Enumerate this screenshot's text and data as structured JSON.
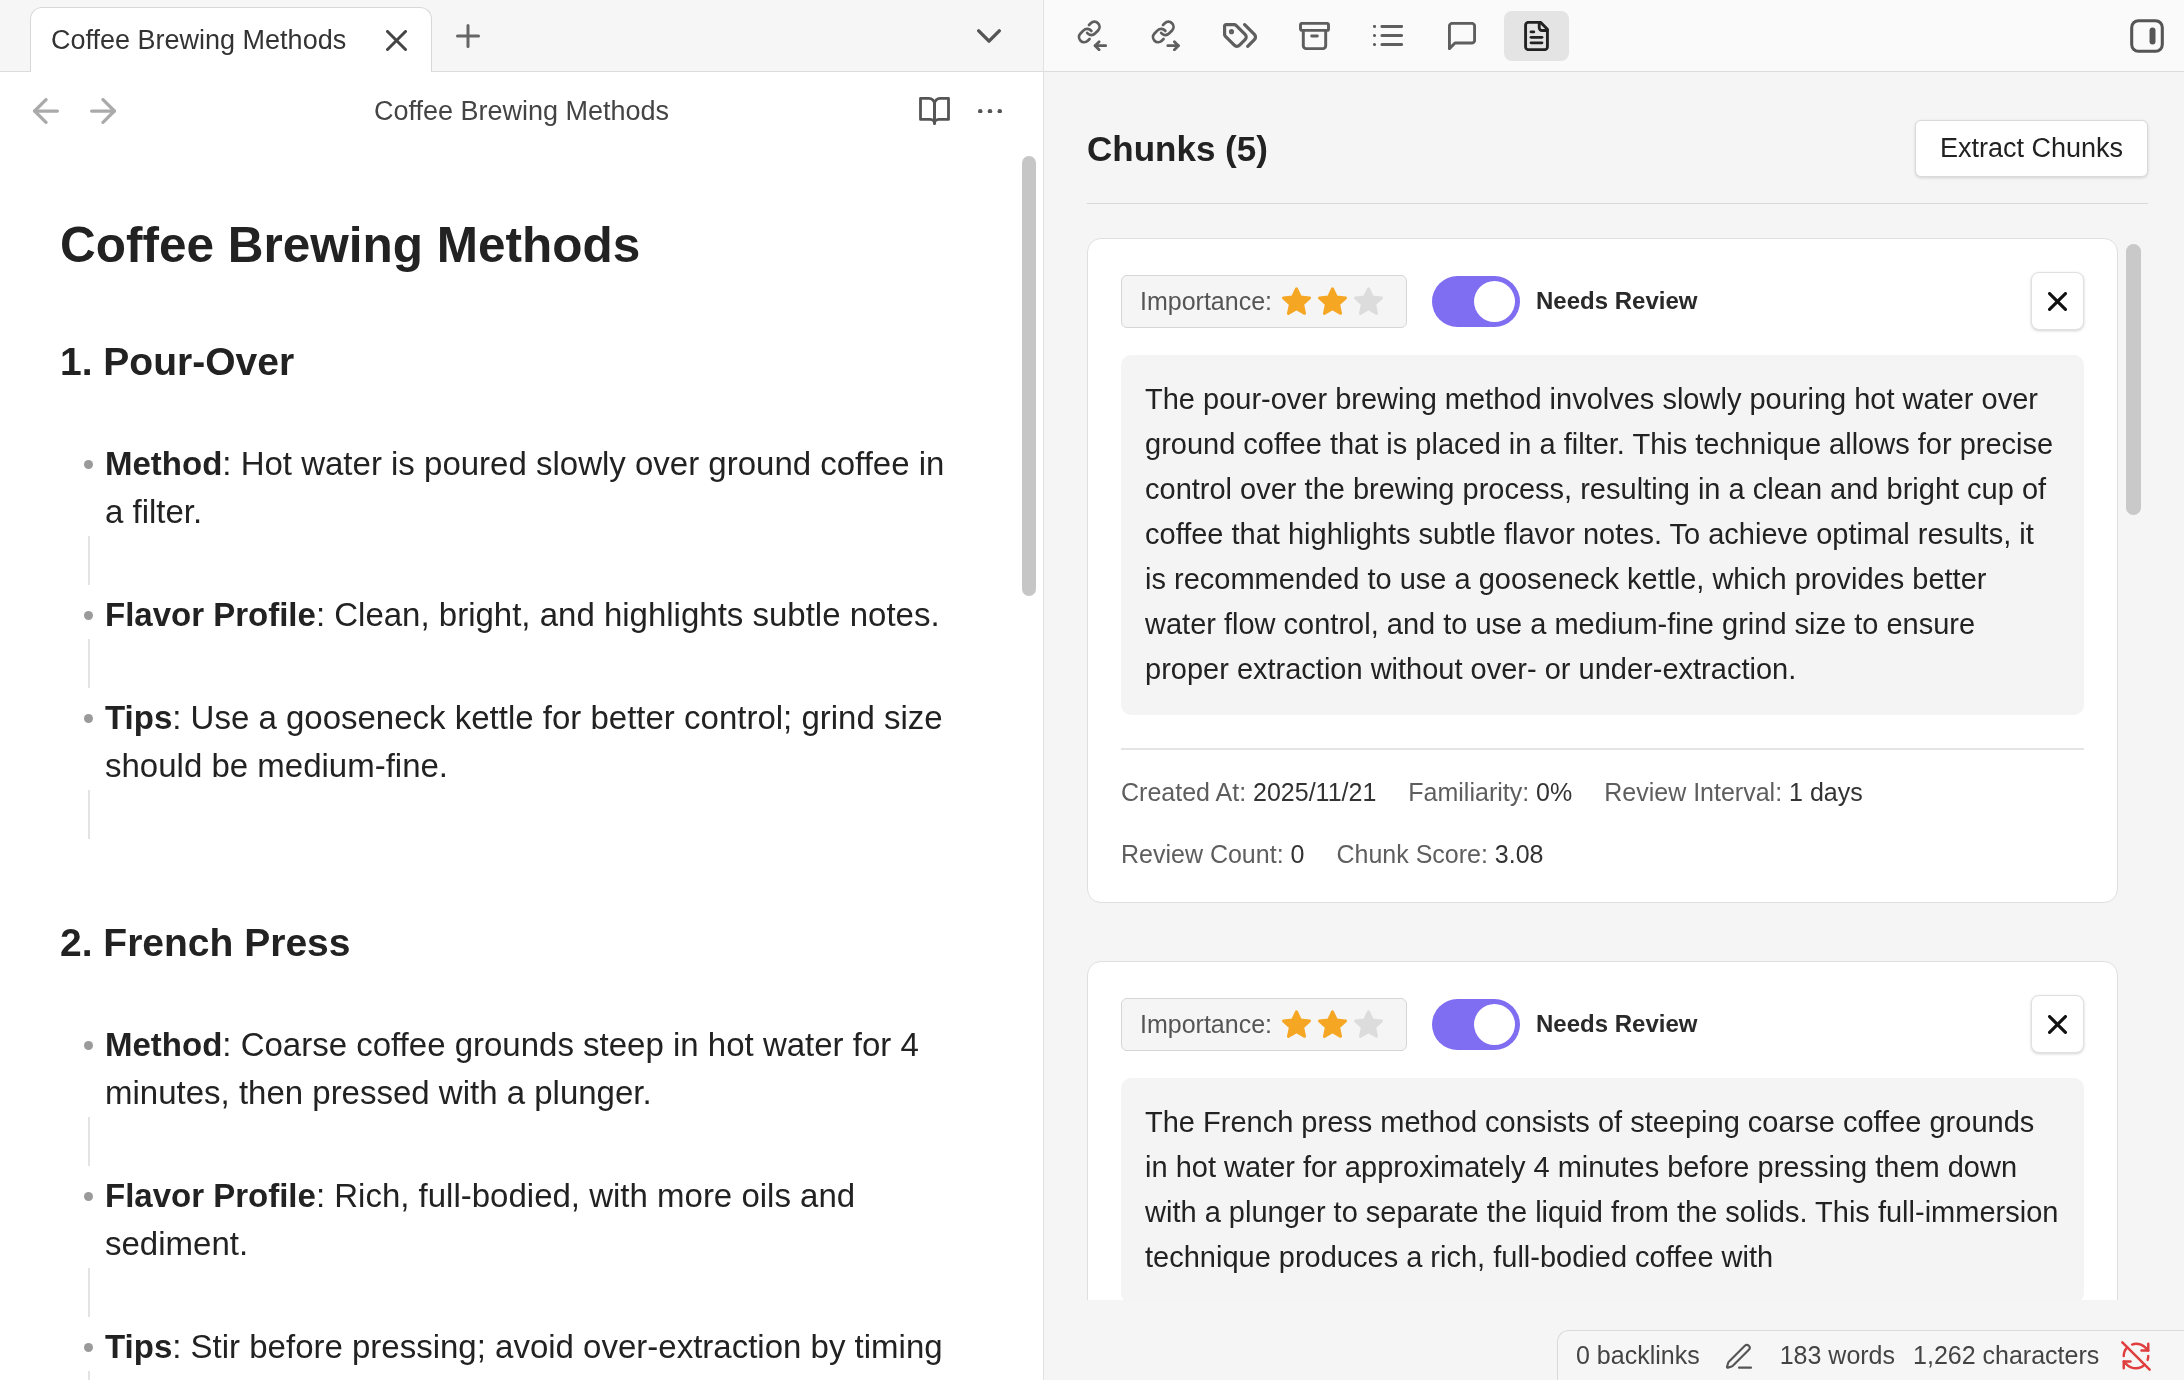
{
  "tab_bar": {
    "tabs": [
      {
        "title": "Coffee Brewing Methods",
        "selected": true
      }
    ]
  },
  "note_header": {
    "title": "Coffee Brewing Methods"
  },
  "note": {
    "title": "Coffee Brewing Methods",
    "sections": [
      {
        "heading": "1. Pour-Over",
        "items": [
          "**Method**: Hot water is poured slowly over ground coffee in a filter.",
          "**Flavor Profile**: Clean, bright, and highlights subtle notes.",
          "**Tips**: Use a gooseneck kettle for better control; grind size should be medium-fine."
        ]
      },
      {
        "heading": "2. French Press",
        "items": [
          "**Method**: Coarse coffee grounds steep in hot water for 4 minutes, then pressed with a plunger.",
          "**Flavor Profile**: Rich, full-bodied, with more oils and sediment.",
          "**Tips**: Stir before pressing; avoid over-extraction by timing"
        ]
      }
    ]
  },
  "side_toolbar": {
    "buttons": [
      {
        "kind": "backlinks",
        "selected": false
      },
      {
        "kind": "outgoing_links",
        "selected": false
      },
      {
        "kind": "tags",
        "selected": false
      },
      {
        "kind": "archive",
        "selected": false
      },
      {
        "kind": "outline",
        "selected": false
      },
      {
        "kind": "comments",
        "selected": false
      },
      {
        "kind": "chunks",
        "selected": true
      }
    ]
  },
  "panel": {
    "title": "Chunks (5)",
    "action": "Extract Chunks",
    "chunks": [
      {
        "importance_label": "Importance:",
        "stars": 2,
        "needs_review": true,
        "review_label": "Needs Review",
        "text": "The pour-over brewing method involves slowly pouring hot water over ground coffee that is placed in a filter. This technique allows for precise control over the brewing process, resulting in a clean and bright cup of coffee that highlights subtle flavor notes. To achieve optimal results, it is recommended to use a gooseneck kettle, which provides better water flow control, and to use a medium-fine grind size to ensure proper extraction without over- or under-extraction.",
        "meta_rows": [
          [
            {
              "label": "Created At:",
              "value": "2025/11/21"
            },
            {
              "label": "Familiarity:",
              "value": "0%"
            },
            {
              "label": "Review Interval:",
              "value": "1 days"
            }
          ],
          [
            {
              "label": "Review Count:",
              "value": "0"
            },
            {
              "label": "Chunk Score:",
              "value": "3.08"
            }
          ]
        ]
      },
      {
        "importance_label": "Importance:",
        "stars": 2,
        "needs_review": true,
        "review_label": "Needs Review",
        "text": "The French press method consists of steeping coarse coffee grounds in hot water for approximately 4 minutes before pressing them down with a plunger to separate the liquid from the solids. This full-immersion technique produces a rich, full-bodied coffee with"
      }
    ]
  },
  "status_bar": {
    "backlinks": "0 backlinks",
    "words": "183 words",
    "characters": "1,262 characters"
  }
}
